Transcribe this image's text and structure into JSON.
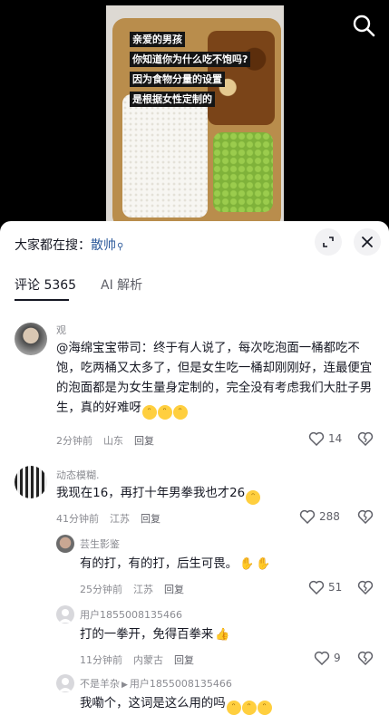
{
  "video": {
    "caption_lines": [
      "亲爱的男孩",
      "你知道你为什么吃不饱吗?",
      "因为食物分量的设置",
      "是根据女性定制的"
    ]
  },
  "sheet": {
    "search_hint": "大家都在搜：",
    "search_keyword": "散帅",
    "tabs": [
      {
        "label": "评论 5365"
      },
      {
        "label": "AI 解析"
      }
    ]
  },
  "comments": [
    {
      "name": "观",
      "text": "@海绵宝宝带司：终于有人说了，每次吃泡面一桶都吃不饱，吃两桶又太多了，但是女生吃一桶却刚刚好，连最便宜的泡面都是为女生量身定制的，完全没有考虑我们大肚子男生，真的好难呀",
      "time": "2分钟前",
      "location": "山东",
      "reply": "回复",
      "likes": "14"
    },
    {
      "name": "动态模糊.",
      "text": "我现在16，再打十年男拳我也才26",
      "time": "41分钟前",
      "location": "江苏",
      "reply": "回复",
      "likes": "288"
    },
    {
      "name": "芸生影鉴",
      "text": "有的打，有的打，后生可畏。",
      "time": "25分钟前",
      "location": "江苏",
      "reply": "回复",
      "likes": "51"
    },
    {
      "name": "用户1855008135466",
      "text": "打的一拳开，免得百拳来",
      "time": "11分钟前",
      "location": "内蒙古",
      "reply": "回复",
      "likes": "9"
    },
    {
      "name": "不是羊杂",
      "reply_to": "用户1855008135466",
      "text": "我嘞个，这词是这么用的吗"
    }
  ]
}
